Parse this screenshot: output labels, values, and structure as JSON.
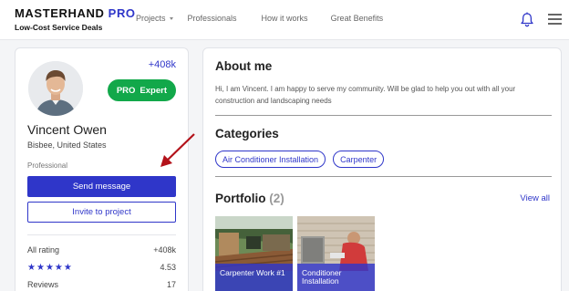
{
  "header": {
    "brand": "MASTERHAND",
    "brand_accent": "PRO",
    "tagline": "Low-Cost Service Deals",
    "nav": [
      {
        "label": "Projects",
        "has_dropdown": true
      },
      {
        "label": "Professionals",
        "has_dropdown": false
      },
      {
        "label": "How it works",
        "has_dropdown": false
      },
      {
        "label": "Great Benefits",
        "has_dropdown": false
      }
    ],
    "icons": {
      "notifications": "bell-icon",
      "menu": "hamburger-menu-icon"
    }
  },
  "profile": {
    "rating_count": "+408k",
    "badge": {
      "pro": "PRO",
      "level": "Expert"
    },
    "name": "Vincent Owen",
    "location": "Bisbee, United States",
    "role": "Professional",
    "send_message_label": "Send message",
    "invite_label": "Invite to project",
    "stats": {
      "all_rating_label": "All rating",
      "all_rating_value": "+408k",
      "stars_rating": 4.53,
      "stars_value": "4.53",
      "reviews_label": "Reviews",
      "reviews_value": "17"
    }
  },
  "about": {
    "title": "About me",
    "text": "Hi, I am Vincent. I am happy to serve my community. Will be glad to help you out with all your construction and landscaping needs"
  },
  "categories": {
    "title": "Categories",
    "items": [
      "Air Conditioner Installation",
      "Carpenter"
    ]
  },
  "portfolio": {
    "title": "Portfolio",
    "count": "(2)",
    "view_all_label": "View all",
    "items": [
      {
        "title": "Carpenter Work #1"
      },
      {
        "title": "Conditioner Installation"
      }
    ]
  },
  "colors": {
    "accent": "#2f36c9",
    "badge_green": "#12a84a",
    "annotation_arrow": "#b3121a"
  }
}
